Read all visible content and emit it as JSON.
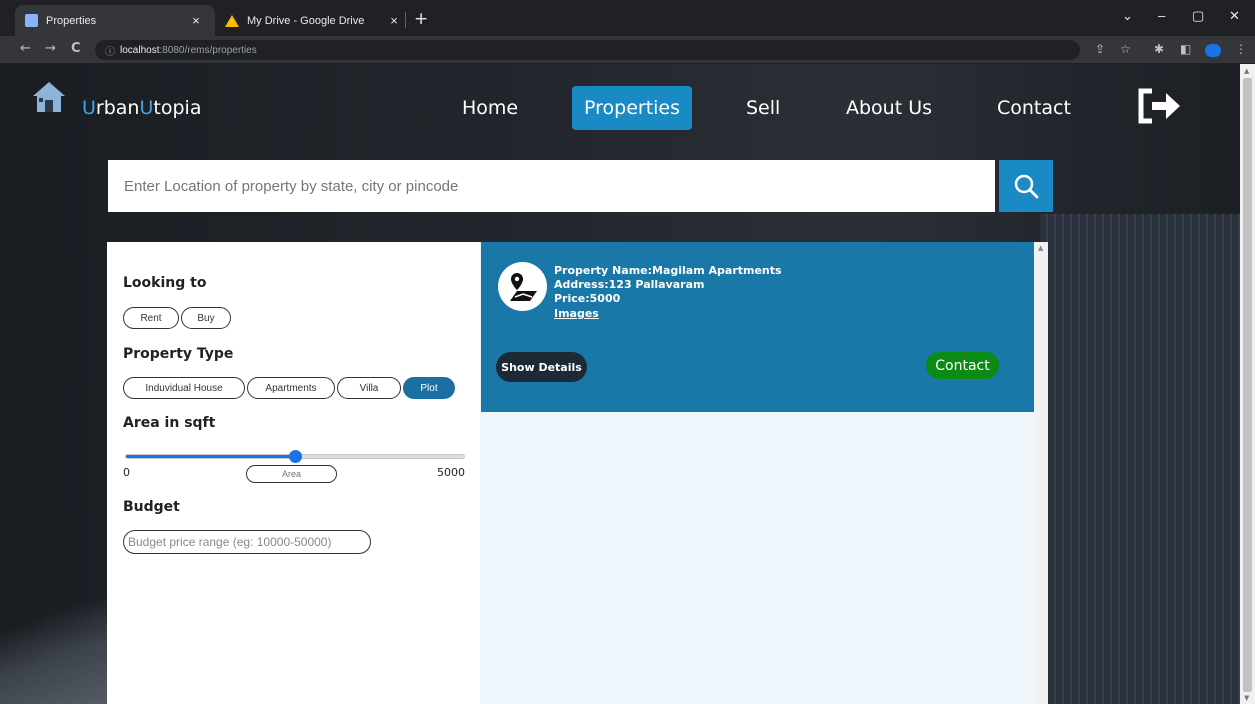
{
  "browser": {
    "tabs": [
      {
        "title": "Properties",
        "active": true
      },
      {
        "title": "My Drive - Google Drive",
        "active": false
      }
    ],
    "new_tab_symbol": "+",
    "close_symbol": "×",
    "url_host": "localhost",
    "url_path": ":8080/rems/properties",
    "window_controls": {
      "minimize": "–",
      "maximize": "▢",
      "close": "✕",
      "tab_search": "⌄"
    },
    "nav_icons": {
      "back": "←",
      "forward": "→",
      "reload": "C",
      "info": "ⓘ"
    },
    "toolbar_icons": [
      "share-icon",
      "star-icon",
      "extensions-icon",
      "sidepanel-icon",
      "profile-icon",
      "menu-icon"
    ]
  },
  "site": {
    "brand_first": "U",
    "brand_rest_1": "rban",
    "brand_second": "U",
    "brand_rest_2": "topia",
    "accent_color": "#3ea6e0",
    "nav": [
      {
        "label": "Home",
        "active": false
      },
      {
        "label": "Properties",
        "active": true
      },
      {
        "label": "Sell",
        "active": false
      },
      {
        "label": "About Us",
        "active": false
      },
      {
        "label": "Contact",
        "active": false
      }
    ]
  },
  "search": {
    "placeholder": "Enter Location of property by state, city or pincode"
  },
  "filters": {
    "looking_to": {
      "heading": "Looking to",
      "options": [
        "Rent",
        "Buy"
      ]
    },
    "property_type": {
      "heading": "Property Type",
      "options": [
        "Induvidual House",
        "Apartments",
        "Villa",
        "Plot"
      ],
      "selected": "Plot"
    },
    "area": {
      "heading": "Area in sqft",
      "min_label": "0",
      "max_label": "5000",
      "slider_fraction": 0.5,
      "input_placeholder": "Area"
    },
    "budget": {
      "heading": "Budget",
      "placeholder": "Budget price range (eg: 10000-50000)"
    }
  },
  "results": [
    {
      "name_line": "Property Name:Magilam Apartments",
      "address_line": "Address:123 Pallavaram",
      "price_line": "Price:5000",
      "images_link": "Images",
      "details_label": "Show Details",
      "contact_label": "Contact"
    }
  ],
  "colors": {
    "primary": "#1a8ac4",
    "card": "#1a78a8",
    "selected_pill": "#1a6fa3",
    "contact_green": "#0b8a15"
  }
}
